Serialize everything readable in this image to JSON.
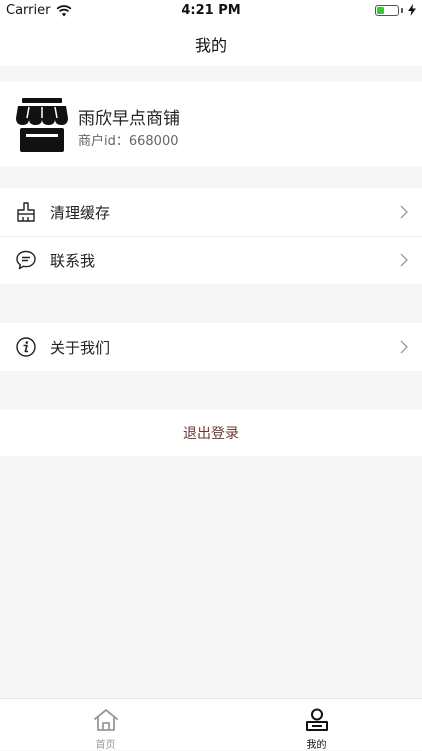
{
  "status_bar": {
    "carrier": "Carrier",
    "time": "4:21 PM"
  },
  "nav": {
    "title": "我的"
  },
  "shop": {
    "name": "雨欣早点商铺",
    "id_label": "商户id：668000"
  },
  "menu": {
    "clear_cache": "清理缓存",
    "contact_me": "联系我",
    "about_us": "关于我们"
  },
  "logout": {
    "label": "退出登录",
    "color": "#6b3a32"
  },
  "tabbar": {
    "home": "首页",
    "mine": "我的"
  },
  "icons": {
    "shop": "storefront-icon",
    "clear_cache": "broom-icon",
    "contact": "chat-bubble-icon",
    "about": "info-icon",
    "chevron": "chevron-right-icon",
    "home": "home-icon",
    "mine": "person-icon"
  },
  "colors": {
    "battery": "#3ec43e",
    "background": "#f6f6f6"
  }
}
